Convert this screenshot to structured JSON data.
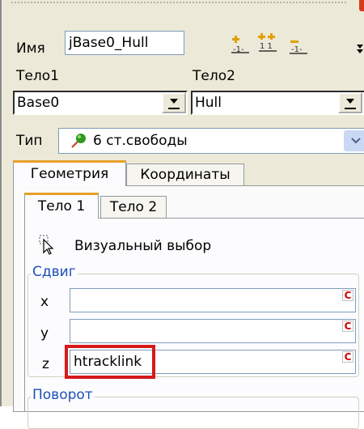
{
  "form": {
    "name_label": "Имя",
    "name_value": "jBase0_Hull",
    "body1_label": "Тело1",
    "body2_label": "Тело2",
    "body1_value": "Base0",
    "body2_value": "Hull",
    "type_label": "Тип",
    "type_value": "6 ст.свободы"
  },
  "toolbar": {
    "icons": [
      "add-node-icon",
      "add-double-node-icon",
      "remove-node-icon"
    ]
  },
  "tabs": {
    "outer": [
      "Геометрия",
      "Координаты"
    ],
    "inner": [
      "Тело 1",
      "Тело 2"
    ]
  },
  "visual_select": "Визуальный выбор",
  "shift": {
    "legend": "Сдвиг",
    "x_label": "x",
    "y_label": "y",
    "z_label": "z",
    "x_value": "",
    "y_value": "",
    "z_value": "htracklink",
    "badge": "C"
  },
  "rotation": {
    "legend": "Поворот"
  },
  "colors": {
    "highlight_box": "#d61a1a",
    "legend_text": "#1f4fb5",
    "tab_accent": "#e8a02a"
  }
}
